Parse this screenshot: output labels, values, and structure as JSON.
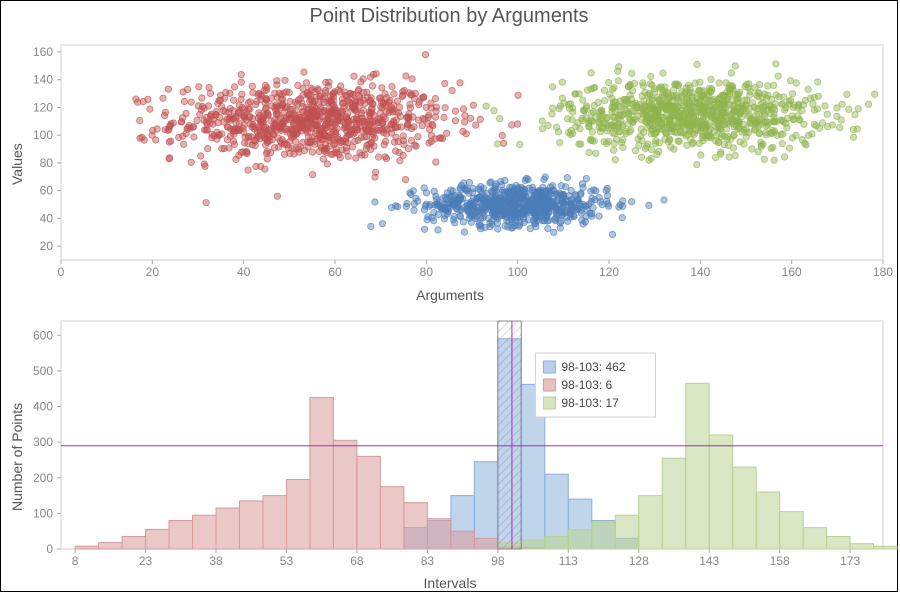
{
  "chart_data": [
    {
      "type": "scatter",
      "title": "Point Distribution by Arguments",
      "xlabel": "Arguments",
      "ylabel": "Values",
      "xlim": [
        0,
        180
      ],
      "ylim": [
        10,
        165
      ],
      "xticks": [
        0,
        20,
        40,
        60,
        80,
        100,
        120,
        140,
        160,
        180
      ],
      "yticks": [
        20,
        40,
        60,
        80,
        100,
        120,
        140,
        160
      ],
      "series": [
        {
          "name": "red",
          "color": "#c05050",
          "center_x": 55,
          "center_y": 110,
          "spread_x": 30,
          "spread_y": 28,
          "n": 900
        },
        {
          "name": "blue",
          "color": "#4b7db8",
          "center_x": 100,
          "center_y": 50,
          "spread_x": 20,
          "spread_y": 15,
          "n": 700
        },
        {
          "name": "green",
          "color": "#90b34e",
          "center_x": 138,
          "center_y": 115,
          "spread_x": 28,
          "spread_y": 25,
          "n": 900
        }
      ]
    },
    {
      "type": "bar",
      "title": "",
      "xlabel": "Intervals",
      "ylabel": "Number of Points",
      "xlim": [
        5,
        180
      ],
      "ylim": [
        0,
        640
      ],
      "yticks": [
        0,
        100,
        200,
        300,
        400,
        500,
        600
      ],
      "categories": [
        8,
        23,
        38,
        53,
        68,
        83,
        98,
        113,
        128,
        143,
        158,
        173
      ],
      "bin_width": 5,
      "series": [
        {
          "name": "blue",
          "color": "#8cb0da",
          "x": [
            78,
            83,
            88,
            93,
            98,
            103,
            108,
            113,
            118,
            123
          ],
          "values": [
            60,
            80,
            150,
            245,
            590,
            462,
            210,
            140,
            80,
            30
          ]
        },
        {
          "name": "red",
          "color": "#d99a9a",
          "x": [
            8,
            13,
            18,
            23,
            28,
            33,
            38,
            43,
            48,
            53,
            58,
            63,
            68,
            73,
            78,
            83,
            88,
            93,
            98,
            103
          ],
          "values": [
            8,
            18,
            35,
            55,
            80,
            95,
            115,
            135,
            150,
            195,
            425,
            305,
            260,
            175,
            130,
            85,
            50,
            30,
            6,
            4
          ]
        },
        {
          "name": "green",
          "color": "#b9d394",
          "x": [
            98,
            103,
            108,
            113,
            118,
            123,
            128,
            133,
            138,
            143,
            148,
            153,
            158,
            163,
            168,
            173,
            178
          ],
          "values": [
            17,
            25,
            35,
            55,
            75,
            95,
            150,
            255,
            465,
            320,
            230,
            160,
            105,
            60,
            35,
            15,
            8
          ]
        }
      ],
      "crosshair": {
        "x": 101,
        "y": 290
      },
      "highlight_bin": {
        "start": 98,
        "end": 103
      },
      "legend": [
        {
          "color": "#8cb0da",
          "label": "98-103: 462"
        },
        {
          "color": "#d99a9a",
          "label": "98-103: 6"
        },
        {
          "color": "#b9d394",
          "label": "98-103: 17"
        }
      ]
    }
  ],
  "title": "Point Distribution by Arguments",
  "scatter": {
    "xlabel": "Arguments",
    "ylabel": "Values"
  },
  "hist": {
    "xlabel": "Intervals",
    "ylabel": "Number of Points"
  },
  "legend": {
    "items": [
      {
        "label": "98-103: 462"
      },
      {
        "label": "98-103: 6"
      },
      {
        "label": "98-103: 17"
      }
    ]
  }
}
